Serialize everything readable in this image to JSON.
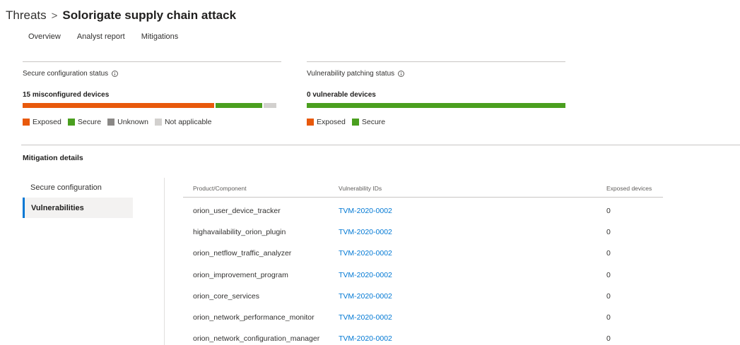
{
  "breadcrumb": {
    "parent": "Threats",
    "separator": ">",
    "current": "Solorigate supply chain attack"
  },
  "tabs": [
    {
      "label": "Overview"
    },
    {
      "label": "Analyst report"
    },
    {
      "label": "Mitigations"
    }
  ],
  "secure_config": {
    "title": "Secure configuration status",
    "count_text": "15 misconfigured devices",
    "bar": {
      "exposed": 0.74,
      "secure": 0.18,
      "unknown": 0,
      "not_applicable": 0.05
    },
    "legend": [
      "Exposed",
      "Secure",
      "Unknown",
      "Not applicable"
    ]
  },
  "vuln_patching": {
    "title": "Vulnerability patching status",
    "count_text": "0 vulnerable devices",
    "bar": {
      "exposed": 0,
      "secure": 1.0
    },
    "legend": [
      "Exposed",
      "Secure"
    ]
  },
  "colors": {
    "exposed": "#e8590c",
    "secure": "#4a9f1f",
    "unknown": "#8a8886",
    "not_applicable": "#d2d0ce",
    "accent": "#0078d4"
  },
  "mitigation": {
    "title": "Mitigation details",
    "nav": [
      {
        "label": "Secure configuration",
        "active": false
      },
      {
        "label": "Vulnerabilities",
        "active": true
      }
    ],
    "columns": [
      "Product/Component",
      "Vulnerability IDs",
      "Exposed devices"
    ],
    "rows": [
      {
        "product": "orion_user_device_tracker",
        "vuln_id": "TVM-2020-0002",
        "exposed": "0"
      },
      {
        "product": "highavailability_orion_plugin",
        "vuln_id": "TVM-2020-0002",
        "exposed": "0"
      },
      {
        "product": "orion_netflow_traffic_analyzer",
        "vuln_id": "TVM-2020-0002",
        "exposed": "0"
      },
      {
        "product": "orion_improvement_program",
        "vuln_id": "TVM-2020-0002",
        "exposed": "0"
      },
      {
        "product": "orion_core_services",
        "vuln_id": "TVM-2020-0002",
        "exposed": "0"
      },
      {
        "product": "orion_network_performance_monitor",
        "vuln_id": "TVM-2020-0002",
        "exposed": "0"
      },
      {
        "product": "orion_network_configuration_manager",
        "vuln_id": "TVM-2020-0002",
        "exposed": "0"
      }
    ]
  }
}
